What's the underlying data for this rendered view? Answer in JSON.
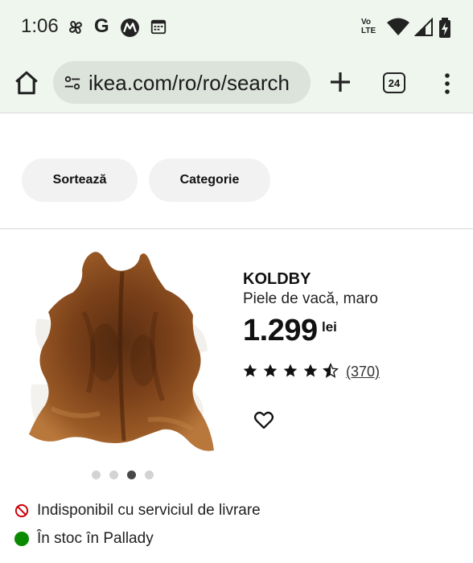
{
  "status_bar": {
    "time": "1:06",
    "notification_icons": [
      "pinwheel-icon",
      "google-icon",
      "motorola-icon",
      "calendar-icon"
    ],
    "google_letter": "G",
    "right_icons": [
      "volte-icon",
      "wifi-icon",
      "signal-icon",
      "battery-icon"
    ],
    "volte_top": "Vo",
    "volte_bottom": "LTE"
  },
  "browser": {
    "url": "ikea.com/ro/ro/search",
    "tab_count": "24",
    "icons": [
      "home-icon",
      "site-settings-icon",
      "new-tab-plus-icon",
      "tab-switcher-icon",
      "more-vert-icon"
    ]
  },
  "filters": {
    "sort_label": "Sortează",
    "category_label": "Categorie"
  },
  "product": {
    "name": "KOLDBY",
    "description": "Piele de vacă, maro",
    "price": "1.299",
    "currency": "lei",
    "rating": 4.5,
    "reviews": "(370)",
    "image_count": 4,
    "active_image_index": 2,
    "image": "brown-white-cowhide-rug"
  },
  "availability": {
    "delivery": "Indisponibil cu serviciul de livrare",
    "store": "În stoc în Pallady",
    "delivery_status_color": "#cc0008",
    "store_status_color": "#0a8a00"
  },
  "colors": {
    "status_bar_bg": "#eff6ee",
    "url_pill_bg": "#dce3db",
    "chip_bg": "#f2f2f2"
  }
}
